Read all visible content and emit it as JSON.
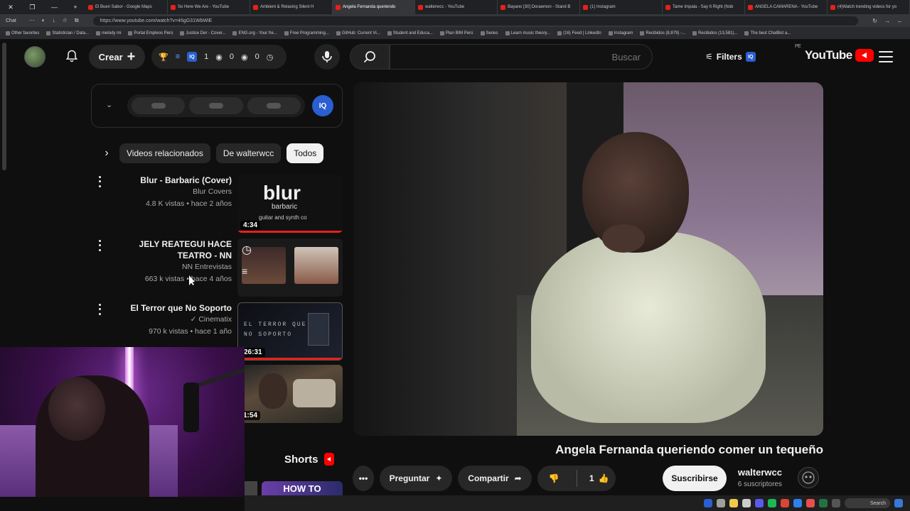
{
  "browser": {
    "tabs": [
      "(4)Watch trending videos for yo",
      "ANGELA CAMARENA - YouTube",
      "Tame Impala - Say It Right (Nob",
      "(1) Instagram",
      "Bayano [30] Doraemon - Stand B",
      "walterwcc - YouTube",
      "Angela Fernanda queriendo",
      "Ambient & Relaxing Silent H",
      "So Here We Are - YouTube",
      "El Buen Sabor - Google Maps"
    ],
    "active_tab_index": 6,
    "url": "https://www.youtube.com/watch?v=46gG31WbWiE",
    "chat_label": "Chat",
    "bookmarks": [
      "The best ChatBot a...",
      "Recibidos (13,581)...",
      "Recibidos (8,879) -...",
      "Instagram",
      "(16) Feed | LinkedIn",
      "Learn music theory...",
      "Series",
      "Plan BIM Perú",
      "Student and Educa...",
      "GitHub: Current Vi...",
      "Free Programming...",
      "ENG.org - Your fre...",
      "Justice Der - Cover...",
      "Portal Empleos Perú",
      "melody mi",
      "Statisticlan / Data...",
      "Other favorites"
    ]
  },
  "header": {
    "logo_text": "YouTube",
    "region": "PE",
    "search_placeholder": "Buscar",
    "filters_label": "Filters",
    "create_label": "Crear",
    "ext_counts": [
      "1",
      "0",
      "0"
    ]
  },
  "ext_panel": {
    "badge": "IQ"
  },
  "chips": [
    "Todos",
    "De walterwcc",
    "Videos relacionados"
  ],
  "recommendations": [
    {
      "title": "Blur - Barbaric (Cover)",
      "channel": "Blur Covers",
      "stats": "4.8 K vistas • hace 2 años",
      "duration": "4:34",
      "thumb_text": "blur",
      "thumb_sub": "barbaric",
      "thumb_small": "guitar and synth co"
    },
    {
      "title": "JELY REATEGUI HACE TEATRO - NN",
      "channel": "NN Entrevistas",
      "stats": "663 k vistas • hace 4 años",
      "duration": ""
    },
    {
      "title": "El Terror que No Soporto",
      "channel": "Cinematix",
      "stats": "970 k vistas • hace 1 año",
      "duration": "26:31",
      "thumb_text": "EL TERROR QUE NO SOPORTO"
    },
    {
      "title": "",
      "channel": "",
      "stats": "",
      "duration": "1:54"
    }
  ],
  "video": {
    "title": "Angela Fernanda queriendo comer un tequeño",
    "channel": "walterwcc",
    "subscribers": "6 suscriptores",
    "subscribe_label": "Suscribirse",
    "likes": "1",
    "share_label": "Compartir",
    "ask_label": "Preguntar"
  },
  "shorts": {
    "label": "Shorts",
    "thumb_text": "HOW TO"
  },
  "taskbar": {
    "search_label": "Search"
  }
}
